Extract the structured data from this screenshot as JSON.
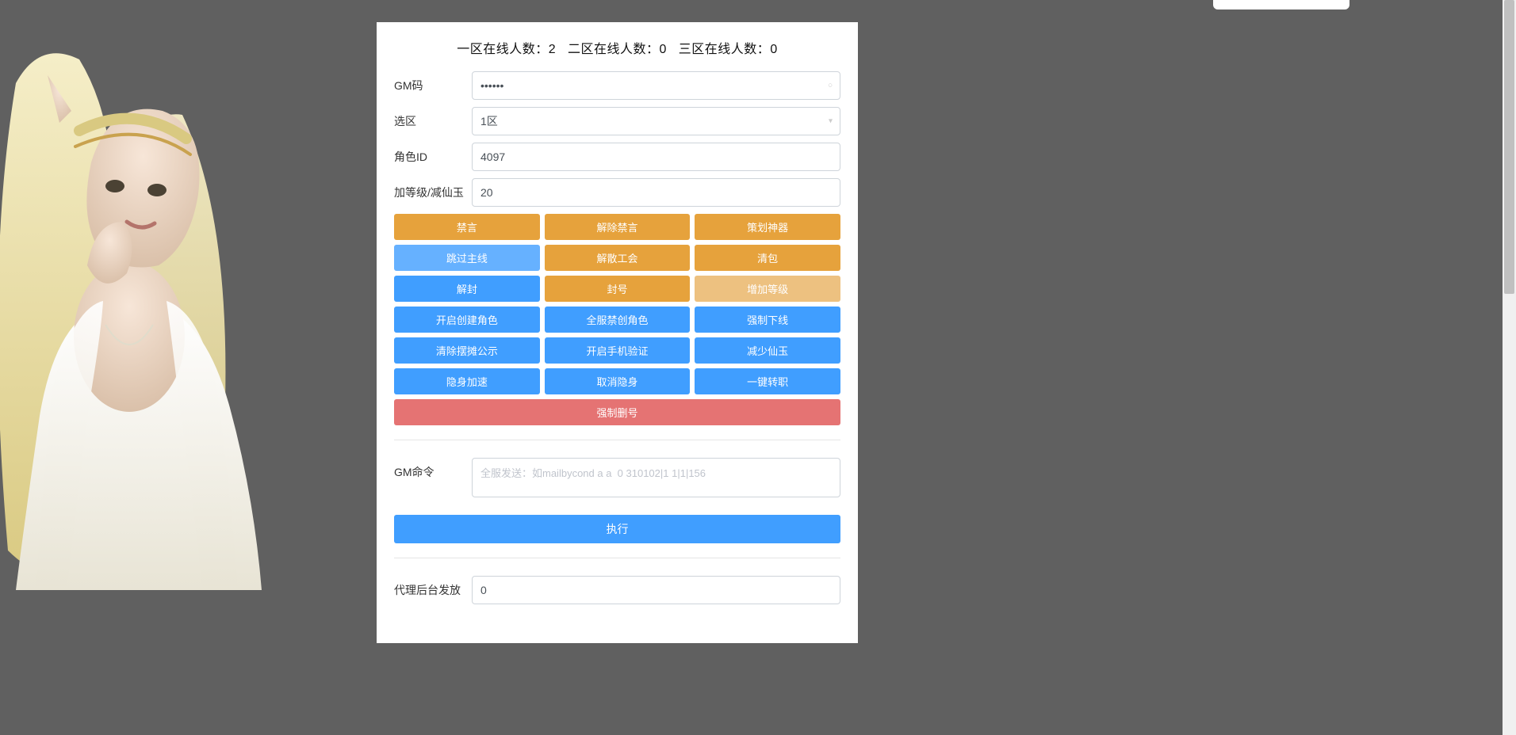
{
  "header": {
    "zone1_label": "一区在线人数：",
    "zone1_count": "2",
    "zone2_label": "二区在线人数：",
    "zone2_count": "0",
    "zone3_label": "三区在线人数：",
    "zone3_count": "0"
  },
  "form": {
    "gm_code_label": "GM码",
    "gm_code_value": "••••••",
    "zone_label": "选区",
    "zone_value": "1区",
    "role_id_label": "角色ID",
    "role_id_value": "4097",
    "level_label": "加等级/减仙玉",
    "level_value": "20"
  },
  "buttons": {
    "r1c1": "禁言",
    "r1c2": "解除禁言",
    "r1c3": "策划神器",
    "r2c1": "跳过主线",
    "r2c2": "解散工会",
    "r2c3": "清包",
    "r3c1": "解封",
    "r3c2": "封号",
    "r3c3": "增加等级",
    "r4c1": "开启创建角色",
    "r4c2": "全服禁创角色",
    "r4c3": "强制下线",
    "r5c1": "清除摆摊公示",
    "r5c2": "开启手机验证",
    "r5c3": "减少仙玉",
    "r6c1": "隐身加速",
    "r6c2": "取消隐身",
    "r6c3": "一键转职",
    "r7": "强制删号"
  },
  "command": {
    "label": "GM命令",
    "placeholder": "全服发送：如mailbycond a a  0 310102|1 1|1|156",
    "exec_label": "执行"
  },
  "agent": {
    "label": "代理后台发放",
    "value": "0"
  }
}
